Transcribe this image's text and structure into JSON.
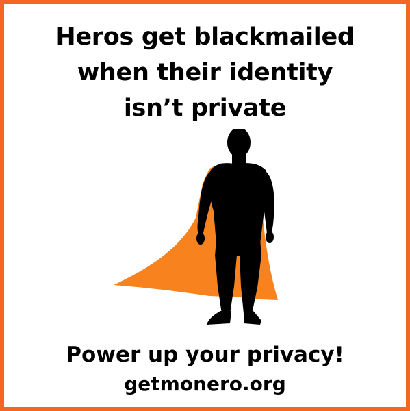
{
  "headline": {
    "line1": "Heros get blackmailed",
    "line2": "when their identity",
    "line3": "isn’t private"
  },
  "tagline": "Power up your privacy!",
  "url": "getmonero.org",
  "colors": {
    "border": "#f26822",
    "cape": "#f7821e",
    "silhouette": "#000000",
    "text": "#000000",
    "background": "#ffffff"
  },
  "illustration": {
    "icon": "superhero-silhouette-icon"
  }
}
